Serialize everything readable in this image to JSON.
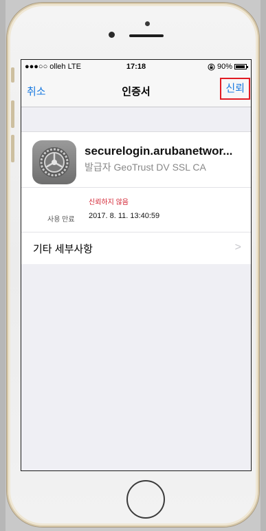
{
  "status_bar": {
    "carrier": "●●●○○ olleh  LTE",
    "time": "17:18",
    "battery": "90%",
    "battery_level": 0.9
  },
  "nav": {
    "cancel_label": "취소",
    "title": "인증서",
    "trust_label": "신뢰"
  },
  "certificate": {
    "name": "securelogin.arubanetwor...",
    "issuer": "발급자 GeoTrust DV SSL CA",
    "trust_status": "신뢰하지 않음",
    "expires_label": "사용 만료",
    "expires_value": "2017. 8. 11. 13:40:59"
  },
  "more_details": {
    "label": "기타 세부사항"
  },
  "colors": {
    "accent": "#1a7ae0",
    "highlight_box": "#e11b22",
    "warning_text": "#d2202f"
  },
  "icons": {
    "cert_icon": "settings-gear-icon",
    "rotation_lock": "rotation-lock-icon",
    "battery": "battery-icon",
    "chevron": "chevron-right-icon"
  }
}
